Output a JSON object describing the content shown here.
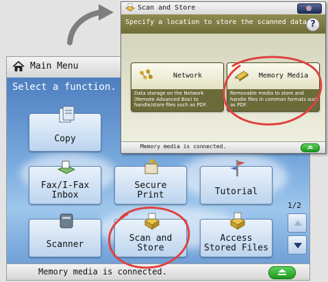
{
  "main_menu": {
    "title": "Main Menu",
    "prompt": "Select a function.",
    "tiles": [
      {
        "line1": "Copy",
        "line2": ""
      },
      {
        "line1": "Fax/I-Fax",
        "line2": "Inbox"
      },
      {
        "line1": "Secure",
        "line2": "Print"
      },
      {
        "line1": "Tutorial",
        "line2": ""
      },
      {
        "line1": "Scanner",
        "line2": ""
      },
      {
        "line1": "Scan and",
        "line2": "Store"
      },
      {
        "line1": "Access",
        "line2": "Stored Files"
      }
    ],
    "page_indicator": "1/2",
    "status": "Memory media is connected."
  },
  "scan_store": {
    "title": "Scan and Store",
    "subtitle": "Specify a location to store the scanned data.",
    "help_label": "?",
    "network": {
      "title": "Network",
      "desc": "Data storage on the Network (Remote Advanced Box) to handle/store files such as PDF."
    },
    "memory_media": {
      "title": "Memory Media",
      "desc": "Removable media to store and handle files in common formats such as PDF."
    },
    "status": "Memory media is connected."
  },
  "colors": {
    "annotation_circle": "#e0413e",
    "arrow": "#7e7e7e",
    "eject_green": "#2fb12f",
    "sky_blue": "#78a9dd",
    "olive_bar": "#7d7a42"
  },
  "icons": [
    "home-icon",
    "copy-icon",
    "fax-icon",
    "secure-print-icon",
    "tutorial-icon",
    "scanner-icon",
    "scan-store-icon",
    "access-files-icon",
    "network-icon",
    "memory-media-icon",
    "eject-icon",
    "help-icon"
  ]
}
